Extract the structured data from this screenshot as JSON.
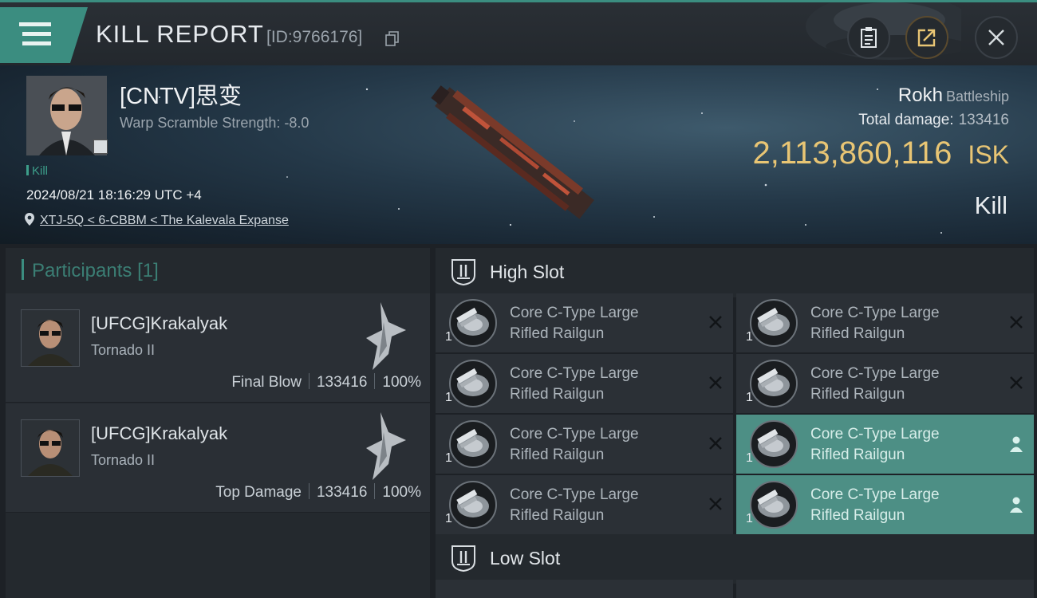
{
  "header": {
    "title": "KILL REPORT",
    "report_id": "[ID:9766176]"
  },
  "victim": {
    "name": "[CNTV]思变",
    "warp_scramble": "Warp Scramble Strength: -8.0",
    "tag": "Kill",
    "datetime": "2024/08/21 18:16:29 UTC +4",
    "location": "XTJ-5Q < 6-CBBM < The Kalevala Expanse"
  },
  "ship": {
    "name": "Rokh",
    "class": "Battleship",
    "total_damage_label": "Total damage:",
    "total_damage_value": "133416",
    "isk_value": "2,113,860,116",
    "isk_unit": "ISK",
    "result": "Kill"
  },
  "participants": {
    "label": "Participants",
    "count": "[1]",
    "rows": [
      {
        "name": "[UFCG]Krakalyak",
        "ship": "Tornado II",
        "role": "Final Blow",
        "damage": "133416",
        "percent": "100%"
      },
      {
        "name": "[UFCG]Krakalyak",
        "ship": "Tornado II",
        "role": "Top Damage",
        "damage": "133416",
        "percent": "100%"
      }
    ]
  },
  "high_slot": {
    "label": "High Slot",
    "modules": [
      {
        "line1": "Core C-Type Large",
        "line2": "Rifled Railgun",
        "qty": "1",
        "status": "destroyed-icon"
      },
      {
        "line1": "Core C-Type Large",
        "line2": "Rifled Railgun",
        "qty": "1",
        "status": "destroyed-icon"
      },
      {
        "line1": "Core C-Type Large",
        "line2": "Rifled Railgun",
        "qty": "1",
        "status": "destroyed-icon"
      },
      {
        "line1": "Core C-Type Large",
        "line2": "Rifled Railgun",
        "qty": "1",
        "status": "destroyed-icon"
      },
      {
        "line1": "Core C-Type Large",
        "line2": "Rifled Railgun",
        "qty": "1",
        "status": "destroyed-icon"
      },
      {
        "line1": "Core C-Type Large",
        "line2": "Rifled Railgun",
        "qty": "1",
        "status": "dropped-person-icon"
      },
      {
        "line1": "Core C-Type Large",
        "line2": "Rifled Railgun",
        "qty": "1",
        "status": "destroyed-icon"
      },
      {
        "line1": "Core C-Type Large",
        "line2": "Rifled Railgun",
        "qty": "1",
        "status": "dropped-person-icon"
      }
    ]
  },
  "low_slot": {
    "label": "Low Slot"
  },
  "colors": {
    "accent": "#3b8d80",
    "isk": "#e8c574",
    "dropped": "#4d8f85"
  }
}
